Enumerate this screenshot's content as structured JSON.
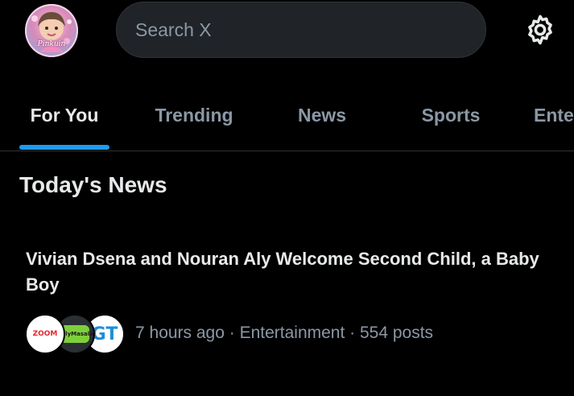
{
  "header": {
    "avatar_caption": "Pinkuin",
    "search": {
      "placeholder": "Search X",
      "value": ""
    },
    "settings_icon": "gear-icon"
  },
  "tabs": [
    {
      "label": "For You",
      "active": true
    },
    {
      "label": "Trending",
      "active": false
    },
    {
      "label": "News",
      "active": false
    },
    {
      "label": "Sports",
      "active": false
    },
    {
      "label": "Ente",
      "active": false
    }
  ],
  "section": {
    "title": "Today's News"
  },
  "news": [
    {
      "headline": "Vivian Dsena and Nouran Aly Welcome Second Child, a Baby Boy",
      "sources": [
        {
          "label": "ZOOM"
        },
        {
          "label": "TellyMasala"
        },
        {
          "label": "GT"
        }
      ],
      "meta": "7 hours ago · Entertainment · 554 posts"
    }
  ],
  "colors": {
    "background": "#000000",
    "accent": "#1d9bf0",
    "text_primary": "#e7e9ea",
    "text_secondary": "#8b98a5",
    "search_bg": "#202327",
    "divider": "#2f3336"
  }
}
